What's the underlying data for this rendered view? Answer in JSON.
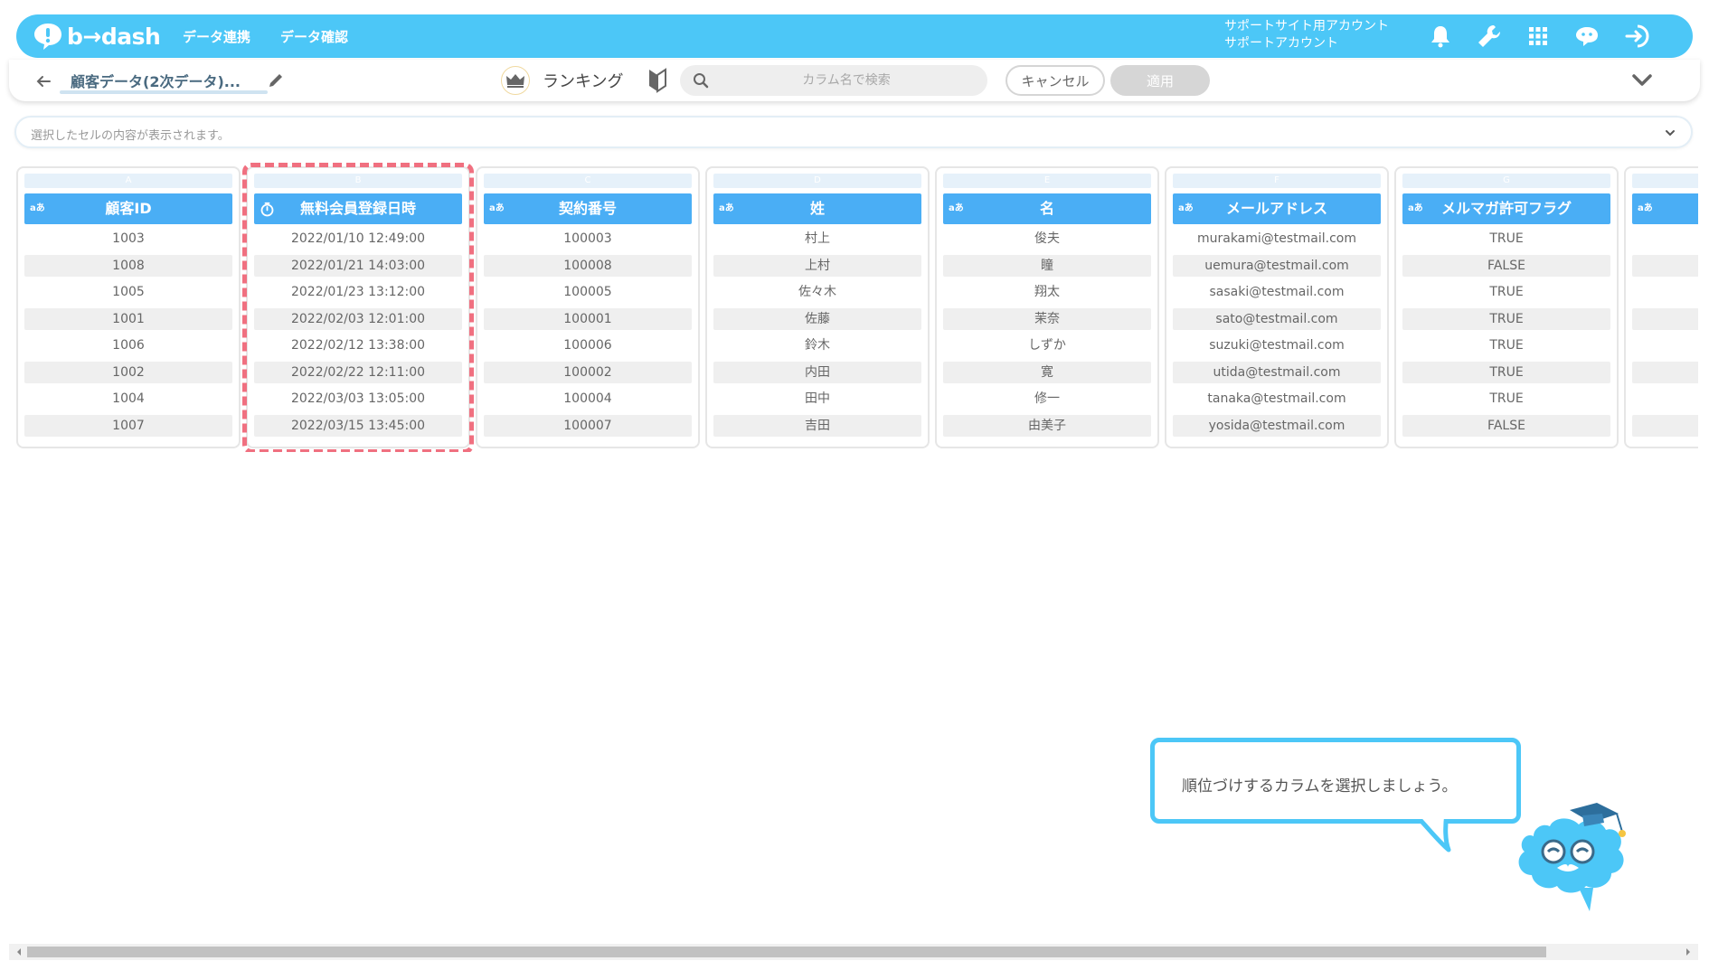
{
  "app": {
    "logo_text": "b→dash"
  },
  "nav": {
    "items": [
      "データ連携",
      "データ確認"
    ]
  },
  "account": {
    "line1": "サポートサイト用アカウント",
    "line2": "サポートアカウント"
  },
  "toolbar": {
    "dataset_title": "顧客データ(2次データ)...",
    "mode_label": "ランキング",
    "search_placeholder": "カラム名で検索",
    "cancel_label": "キャンセル",
    "apply_label": "適用"
  },
  "cellbar": {
    "placeholder": "選択したセルの内容が表示されます。"
  },
  "columns": [
    {
      "letter": "A",
      "header": "顧客ID",
      "type": "text",
      "type_label": "aあ",
      "cells": [
        "1003",
        "1008",
        "1005",
        "1001",
        "1006",
        "1002",
        "1004",
        "1007"
      ]
    },
    {
      "letter": "B",
      "header": "無料会員登録日時",
      "type": "datetime",
      "type_label": "",
      "cells": [
        "2022/01/10 12:49:00",
        "2022/01/21 14:03:00",
        "2022/01/23 13:12:00",
        "2022/02/03 12:01:00",
        "2022/02/12 13:38:00",
        "2022/02/22 12:11:00",
        "2022/03/03 13:05:00",
        "2022/03/15 13:45:00"
      ]
    },
    {
      "letter": "C",
      "header": "契約番号",
      "type": "text",
      "type_label": "aあ",
      "cells": [
        "100003",
        "100008",
        "100005",
        "100001",
        "100006",
        "100002",
        "100004",
        "100007"
      ]
    },
    {
      "letter": "D",
      "header": "姓",
      "type": "text",
      "type_label": "aあ",
      "cells": [
        "村上",
        "上村",
        "佐々木",
        "佐藤",
        "鈴木",
        "内田",
        "田中",
        "吉田"
      ]
    },
    {
      "letter": "E",
      "header": "名",
      "type": "text",
      "type_label": "aあ",
      "cells": [
        "俊夫",
        "瞳",
        "翔太",
        "茉奈",
        "しずか",
        "寛",
        "修一",
        "由美子"
      ]
    },
    {
      "letter": "F",
      "header": "メールアドレス",
      "type": "text",
      "type_label": "aあ",
      "cells": [
        "murakami@testmail.com",
        "uemura@testmail.com",
        "sasaki@testmail.com",
        "sato@testmail.com",
        "suzuki@testmail.com",
        "utida@testmail.com",
        "tanaka@testmail.com",
        "yosida@testmail.com"
      ]
    },
    {
      "letter": "G",
      "header": "メルマガ許可フラグ",
      "type": "text",
      "type_label": "aあ",
      "cells": [
        "TRUE",
        "FALSE",
        "TRUE",
        "TRUE",
        "TRUE",
        "TRUE",
        "TRUE",
        "FALSE"
      ]
    },
    {
      "letter": "H",
      "header": "",
      "type": "text",
      "type_label": "aあ",
      "cells": [
        "",
        "",
        "",
        "",
        "",
        "",
        "",
        ""
      ]
    }
  ],
  "tooltip": {
    "text": "順位づけするカラムを選択しましょう。"
  },
  "colors": {
    "brand": "#4cc7f7",
    "column_header": "#4aaef5",
    "highlight_dash": "#f07080",
    "apply_disabled": "#d6d6d6"
  },
  "icons": [
    "bell-icon",
    "wrench-icon",
    "grid-apps-icon",
    "chat-icon",
    "logout-icon",
    "back-arrow-icon",
    "pencil-icon",
    "crown-icon",
    "beginner-mark-icon",
    "search-icon",
    "chevron-down-icon",
    "stopwatch-icon"
  ]
}
